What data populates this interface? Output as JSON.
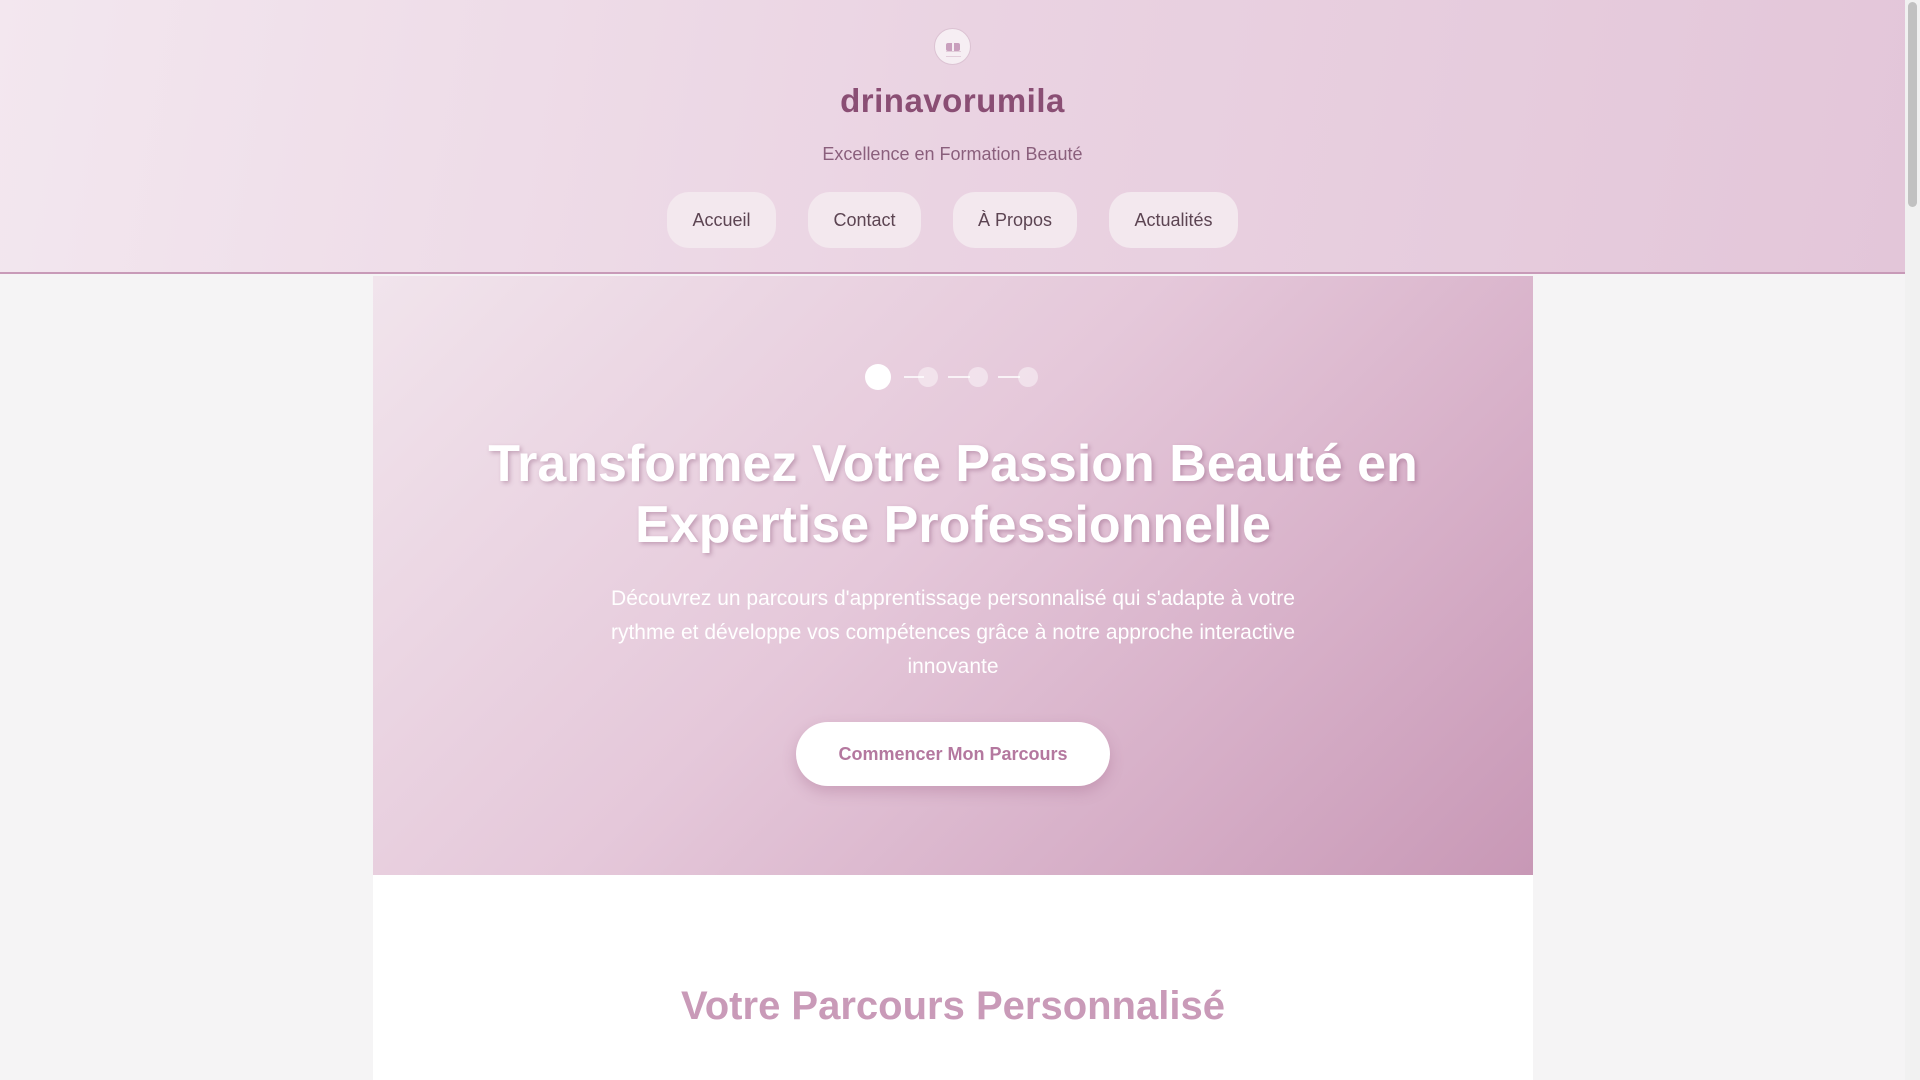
{
  "header": {
    "logo_icon": "book-icon",
    "title": "drinavorumila",
    "tagline": "Excellence en Formation Beauté",
    "nav": [
      {
        "label": "Accueil"
      },
      {
        "label": "Contact"
      },
      {
        "label": "À Propos"
      },
      {
        "label": "Actualités"
      }
    ]
  },
  "hero": {
    "progress": {
      "total_steps": 4,
      "current_step": 1
    },
    "title": "Transformez Votre Passion Beauté en Expertise Professionnelle",
    "description": "Découvrez un parcours d'apprentissage personnalisé qui s'adapte à votre rythme et développe vos compétences grâce à notre approche interactive innovante",
    "cta_label": "Commencer Mon Parcours"
  },
  "section": {
    "title": "Votre Parcours Personnalisé"
  },
  "colors": {
    "title": "#8a4e74",
    "accent": "#c99ab8",
    "cta_text": "#b4789f",
    "nav_bg": "#f3e8ee"
  }
}
